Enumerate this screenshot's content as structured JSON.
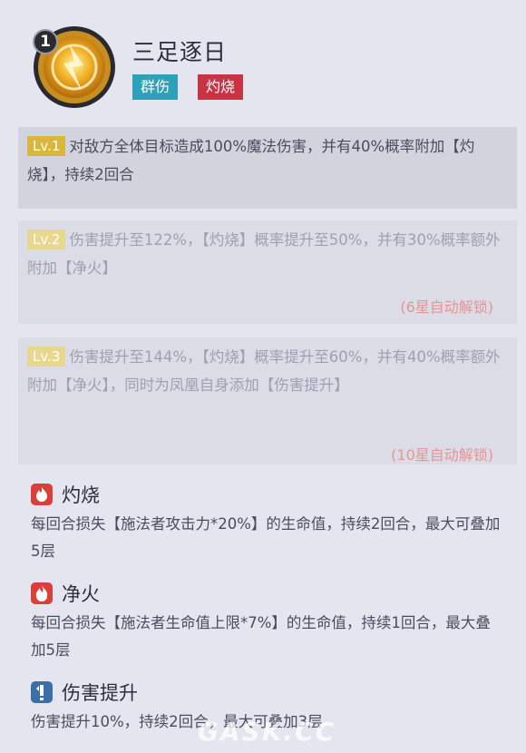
{
  "skill": {
    "rank": "1",
    "name": "三足逐日",
    "tags": [
      "群伤",
      "灼烧"
    ]
  },
  "levels": [
    {
      "badge": "Lv.1",
      "text": "对敌方全体目标造成100%魔法伤害，并有40%概率附加【灼烧】，持续2回合",
      "unlock": ""
    },
    {
      "badge": "Lv.2",
      "text": "伤害提升至122%，【灼烧】概率提升至50%，并有30%概率额外附加【净火】",
      "unlock": "(6星自动解锁)"
    },
    {
      "badge": "Lv.3",
      "text": "伤害提升至144%，【灼烧】概率提升至60%，并有40%概率额外附加【净火】，同时为凤凰自身添加【伤害提升】",
      "unlock": "(10星自动解锁)"
    }
  ],
  "statuses": [
    {
      "icon": "flame-icon",
      "title": "灼烧",
      "desc": "每回合损失【施法者攻击力*20%】的生命值，持续2回合，最大可叠加5层"
    },
    {
      "icon": "fire-icon",
      "title": "净火",
      "desc": "每回合损失【施法者生命值上限*7%】的生命值，持续1回合，最大叠加5层"
    },
    {
      "icon": "damage-up-icon",
      "title": "伤害提升",
      "desc": "伤害提升10%，持续2回合，最大可叠加3层"
    }
  ],
  "watermark": "GASK.CC",
  "colors": {
    "tag_aoe": "#2fa0b9",
    "tag_burn": "#c93445",
    "lv1_badge": "#d9b63e",
    "unlock": "#e49595"
  }
}
